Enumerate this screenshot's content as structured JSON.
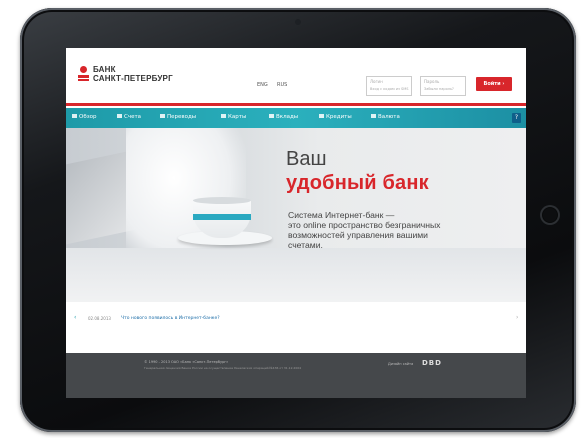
{
  "bank": {
    "logo_line1": "БАНК",
    "logo_line2": "САНКТ-ПЕТЕРБУРГ",
    "accent_color": "#d8262b",
    "nav_color": "#2bb0bd"
  },
  "header": {
    "lang_en": "ENG",
    "lang_ru": "RUS",
    "login_placeholder": "Логин",
    "login_hint": "Вход с кодом из SMS",
    "password_placeholder": "Пароль",
    "password_hint": "Забыли пароль?",
    "enter_label": "Войти"
  },
  "nav": {
    "items": [
      {
        "label": "Обзор",
        "icon": "overview-icon"
      },
      {
        "label": "Счета",
        "icon": "accounts-icon"
      },
      {
        "label": "Переводы",
        "icon": "transfers-icon"
      },
      {
        "label": "Карты",
        "icon": "cards-icon"
      },
      {
        "label": "Вклады",
        "icon": "deposits-icon"
      },
      {
        "label": "Кредиты",
        "icon": "loans-icon"
      },
      {
        "label": "Валюта",
        "icon": "currency-icon"
      }
    ],
    "help_label": "?"
  },
  "hero": {
    "title_line1": "Ваш",
    "title_line2": "удобный банк",
    "text_line1": "Система Интернет-банк —",
    "text_line2": "это online пространство безграничных",
    "text_line3": "возможностей управления вашими",
    "text_line4": "счетами."
  },
  "news": {
    "date": "02.08.2013",
    "link_text": "Что нового появилось в Интернет-банке?"
  },
  "footer": {
    "copyright": "© 1990 - 2013 ОАО «Банк «Санкт-Петербург»",
    "small_text": "Генеральная лицензия Банка России на осуществление банковских операций №436 от 31.12.2004",
    "dev_label": "Дизайн сайта",
    "dev_brand": "DBD"
  }
}
